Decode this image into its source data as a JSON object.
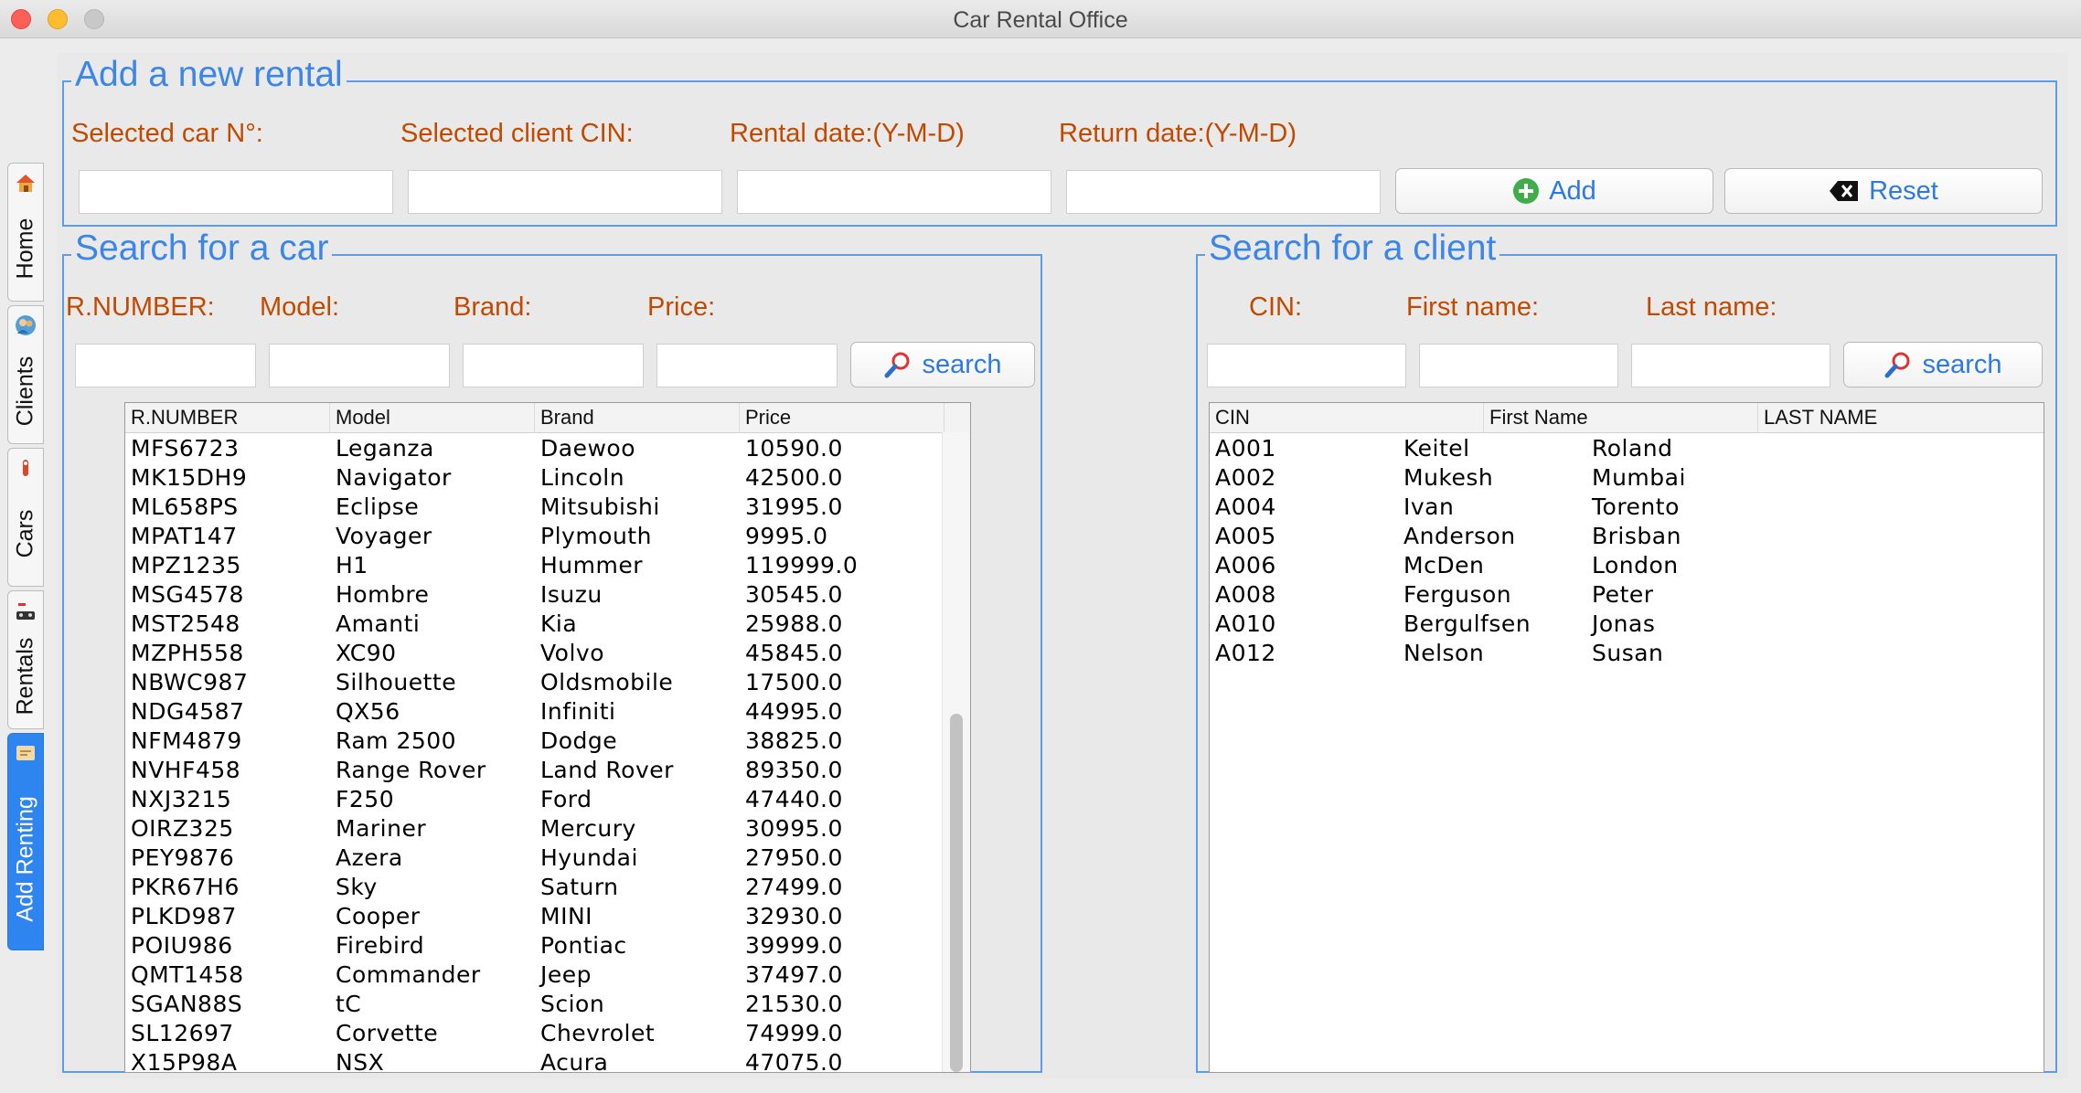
{
  "window": {
    "title": "Car Rental Office"
  },
  "tabs": [
    {
      "label": "Home",
      "icon": "house-icon"
    },
    {
      "label": "Clients",
      "icon": "users-icon"
    },
    {
      "label": "Cars",
      "icon": "car-icon"
    },
    {
      "label": "Rentals",
      "icon": "rental-icon"
    },
    {
      "label": "Add Renting",
      "icon": "add-renting-icon",
      "active": true
    }
  ],
  "add_rental": {
    "title": "Add a new rental",
    "car_label": "Selected car N°:",
    "client_label": "Selected client CIN:",
    "rental_date_label": "Rental date:(Y-M-D)",
    "return_date_label": "Return date:(Y-M-D)",
    "car_value": "",
    "client_value": "",
    "rental_date_value": "",
    "return_date_value": "",
    "add_button": "Add",
    "reset_button": "Reset"
  },
  "car_search": {
    "title": "Search for a car",
    "labels": {
      "rnumber": "R.NUMBER:",
      "model": "Model:",
      "brand": "Brand:",
      "price": "Price:"
    },
    "button": "search",
    "columns": [
      "R.NUMBER",
      "Model",
      "Brand",
      "Price"
    ],
    "rows": [
      [
        "MFS6723",
        "Leganza",
        "Daewoo",
        "10590.0"
      ],
      [
        "MK15DH9",
        "Navigator",
        "Lincoln",
        "42500.0"
      ],
      [
        "ML658PS",
        "Eclipse",
        "Mitsubishi",
        "31995.0"
      ],
      [
        "MPAT147",
        "Voyager",
        "Plymouth",
        "9995.0"
      ],
      [
        "MPZ1235",
        "H1",
        "Hummer",
        "119999.0"
      ],
      [
        "MSG4578",
        "Hombre",
        "Isuzu",
        "30545.0"
      ],
      [
        "MST2548",
        "Amanti",
        "Kia",
        "25988.0"
      ],
      [
        "MZPH558",
        "XC90",
        "Volvo",
        "45845.0"
      ],
      [
        "NBWC987",
        "Silhouette",
        "Oldsmobile",
        "17500.0"
      ],
      [
        "NDG4587",
        "QX56",
        "Infiniti",
        "44995.0"
      ],
      [
        "NFM4879",
        "Ram 2500",
        "Dodge",
        "38825.0"
      ],
      [
        "NVHF458",
        "Range Rover",
        "Land Rover",
        "89350.0"
      ],
      [
        "NXJ3215",
        "F250",
        "Ford",
        "47440.0"
      ],
      [
        "OIRZ325",
        "Mariner",
        "Mercury",
        "30995.0"
      ],
      [
        "PEY9876",
        "Azera",
        "Hyundai",
        "27950.0"
      ],
      [
        "PKR67H6",
        "Sky",
        "Saturn",
        "27499.0"
      ],
      [
        "PLKD987",
        "Cooper",
        "MINI",
        "32930.0"
      ],
      [
        "POIU986",
        "Firebird",
        "Pontiac",
        "39999.0"
      ],
      [
        "QMT1458",
        "Commander",
        "Jeep",
        "37497.0"
      ],
      [
        "SGAN88S",
        "tC",
        "Scion",
        "21530.0"
      ],
      [
        "SL12697",
        "Corvette",
        "Chevrolet",
        "74999.0"
      ],
      [
        "X15P98A",
        "NSX",
        "Acura",
        "47075.0"
      ]
    ]
  },
  "client_search": {
    "title": "Search for a client",
    "labels": {
      "cin": "CIN:",
      "first_name": "First name:",
      "last_name": "Last name:"
    },
    "button": "search",
    "columns": [
      "CIN",
      "First Name",
      "LAST NAME"
    ],
    "rows": [
      [
        "A001",
        "Keitel",
        "Roland"
      ],
      [
        "A002",
        "Mukesh",
        "Mumbai"
      ],
      [
        "A004",
        "Ivan",
        "Torento"
      ],
      [
        "A005",
        "Anderson",
        "Brisban"
      ],
      [
        "A006",
        "McDen",
        "London"
      ],
      [
        "A008",
        "Ferguson",
        "Peter"
      ],
      [
        "A010",
        "Bergulfsen",
        "Jonas"
      ],
      [
        "A012",
        "Nelson",
        "Susan"
      ]
    ]
  }
}
